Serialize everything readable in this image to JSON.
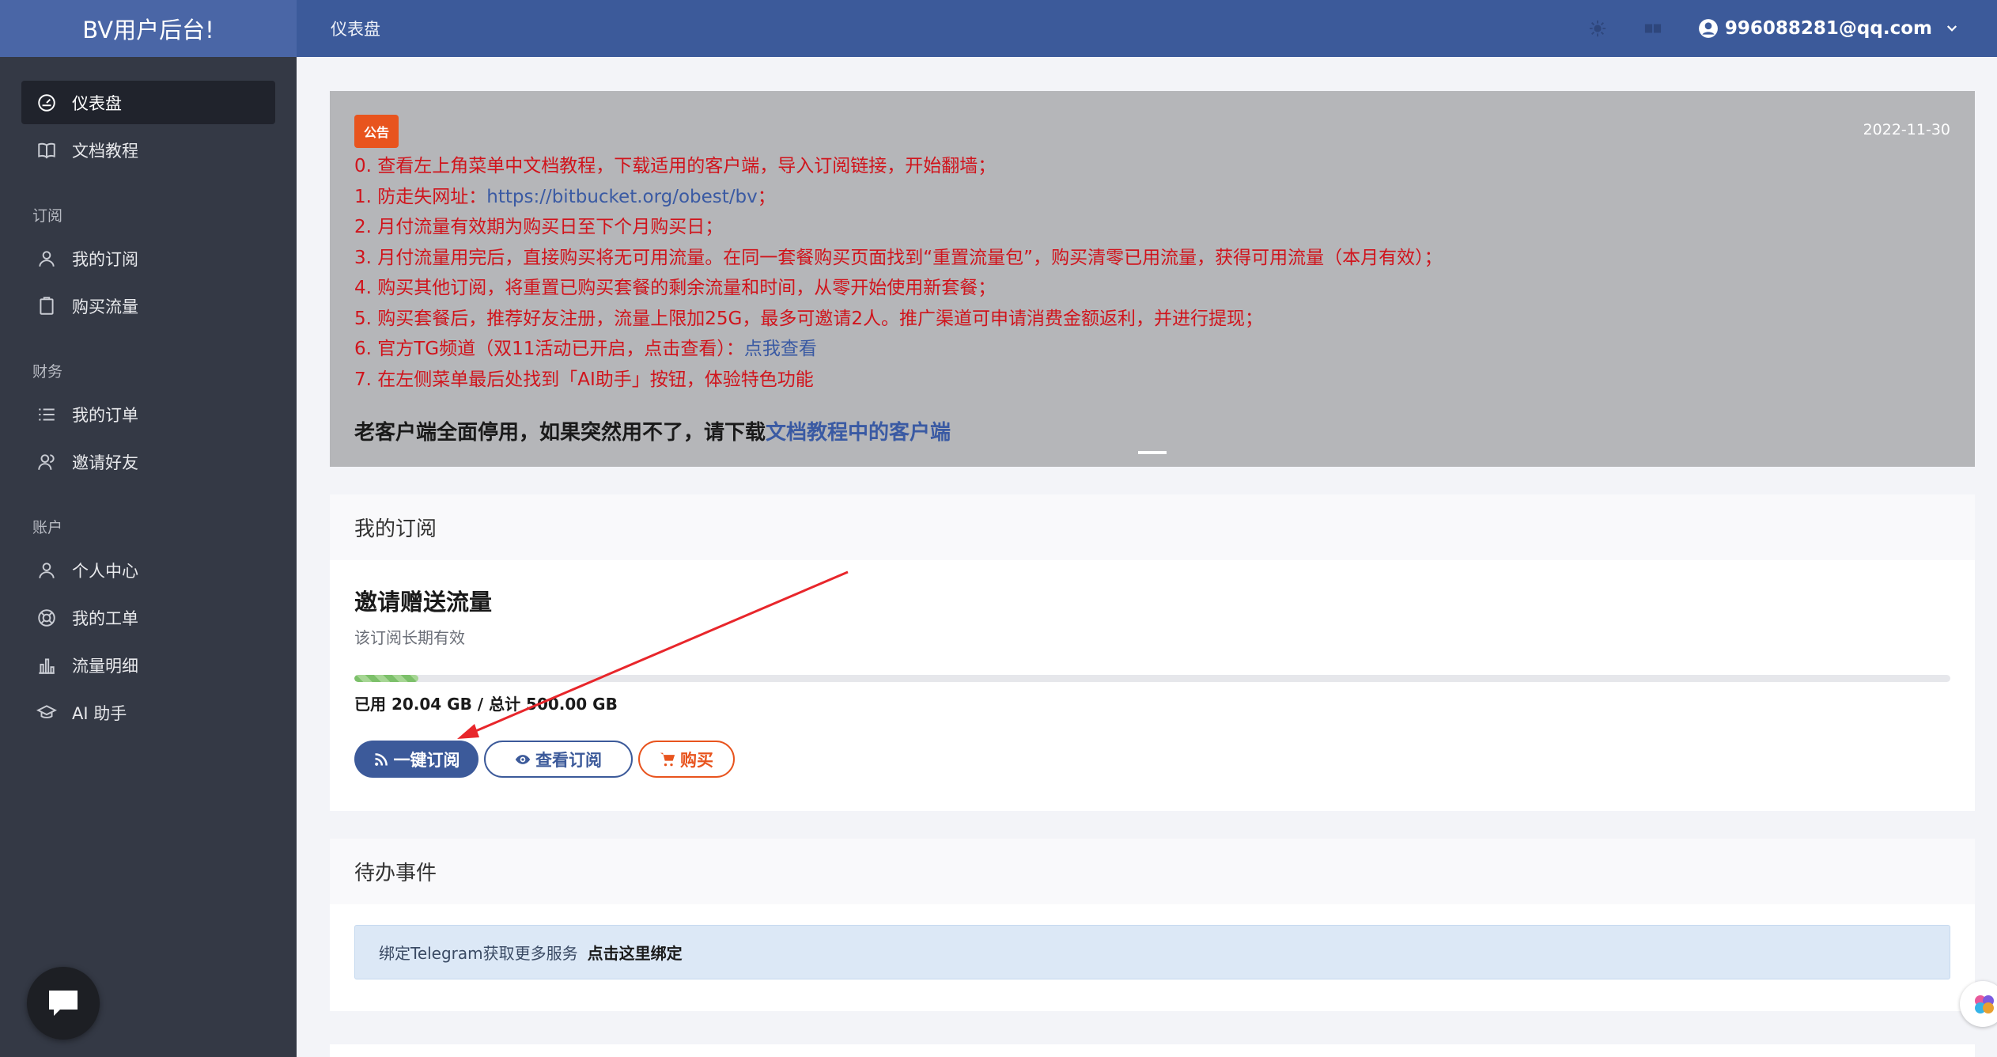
{
  "app": {
    "brand": "BV用户后台!"
  },
  "header": {
    "page_title": "仪表盘",
    "user_email": "996088281@qq.com"
  },
  "sidebar": {
    "items": [
      {
        "label": "仪表盘",
        "icon": "dashboard-icon",
        "active": true
      },
      {
        "label": "文档教程",
        "icon": "book-icon"
      }
    ],
    "sections": [
      {
        "title": "订阅",
        "items": [
          {
            "label": "我的订阅",
            "icon": "user-icon"
          },
          {
            "label": "购买流量",
            "icon": "clipboard-icon"
          }
        ]
      },
      {
        "title": "财务",
        "items": [
          {
            "label": "我的订单",
            "icon": "list-icon"
          },
          {
            "label": "邀请好友",
            "icon": "users-icon"
          }
        ]
      },
      {
        "title": "账户",
        "items": [
          {
            "label": "个人中心",
            "icon": "user-icon"
          },
          {
            "label": "我的工单",
            "icon": "lifebuoy-icon"
          },
          {
            "label": "流量明细",
            "icon": "bar-chart-icon"
          },
          {
            "label": "AI 助手",
            "icon": "graduation-cap-icon"
          }
        ]
      }
    ]
  },
  "notice": {
    "badge": "公告",
    "date": "2022-11-30",
    "lines": {
      "l0": "0. 查看左上角菜单中文档教程，下载适用的客户端，导入订阅链接，开始翻墙；",
      "l1_prefix": "1. 防走失网址：",
      "l1_link": "https://bitbucket.org/obest/bv",
      "l1_suffix": "；",
      "l2": "2. 月付流量有效期为购买日至下个月购买日；",
      "l3": "3. 月付流量用完后，直接购买将无可用流量。在同一套餐购买页面找到“重置流量包”，购买清零已用流量，获得可用流量（本月有效）；",
      "l4": "4. 购买其他订阅，将重置已购买套餐的剩余流量和时间，从零开始使用新套餐；",
      "l5": "5. 购买套餐后，推荐好友注册，流量上限加25G，最多可邀请2人。推广渠道可申请消费金额返利，并进行提现；",
      "l6_prefix": "6. 官方TG频道（双11活动已开启，点击查看）：",
      "l6_link": "点我查看",
      "l7": "7. 在左侧菜单最后处找到「AI助手」按钮，体验特色功能"
    },
    "bold_prefix": "老客户端全面停用，如果突然用不了，请下载",
    "bold_link": "文档教程中的客户端"
  },
  "subscription": {
    "card_title": "我的订阅",
    "plan_name": "邀请赠送流量",
    "plan_desc": "该订阅长期有效",
    "usage_fraction": 0.04,
    "usage_text": "已用 20.04 GB / 总计 500.00 GB",
    "buttons": {
      "subscribe": "一键订阅",
      "view": "查看订阅",
      "buy": "购买"
    }
  },
  "todo": {
    "card_title": "待办事件",
    "telegram_text": "绑定Telegram获取更多服务",
    "telegram_link": "点击这里绑定"
  },
  "colors": {
    "sidebar_bg": "#343945",
    "header_bg": "#3c5a9a",
    "brand_bg": "#4a66a6",
    "notice_text": "#d0141c",
    "accent_orange": "#e8541e",
    "annotation_arrow": "#e8262b"
  }
}
